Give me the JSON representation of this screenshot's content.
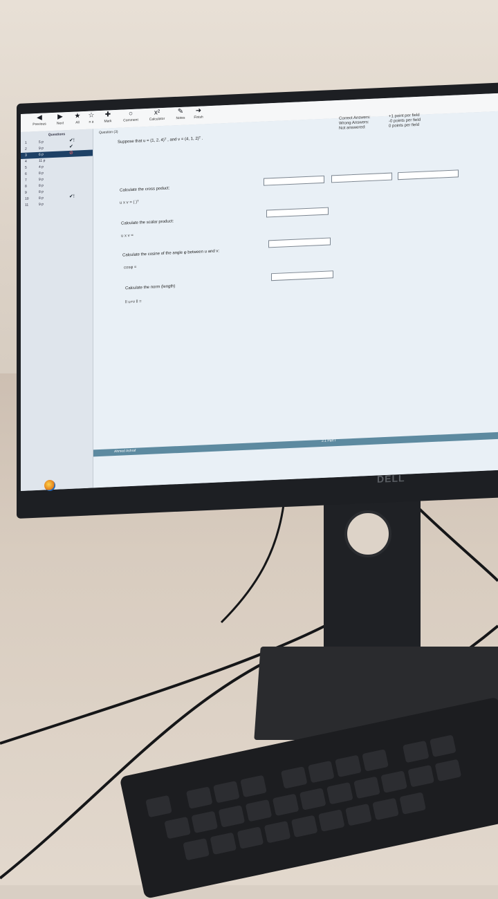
{
  "toolbar": {
    "previous": "Previous",
    "next": "Next",
    "all": "All",
    "na": "n a",
    "mark": "Mark",
    "comment": "Comment",
    "calculator": "Calculator",
    "notes": "Notes",
    "finish": "Finish"
  },
  "sidebar": {
    "title": "Questions",
    "items": [
      {
        "num": "1",
        "pts": "5 p",
        "status": "✔!"
      },
      {
        "num": "2",
        "pts": "9 p",
        "status": "✔"
      },
      {
        "num": "3",
        "pts": "6 p",
        "status": "⊘"
      },
      {
        "num": "4",
        "pts": "11 p",
        "status": ""
      },
      {
        "num": "5",
        "pts": "4 p",
        "status": ""
      },
      {
        "num": "6",
        "pts": "8 p",
        "status": ""
      },
      {
        "num": "7",
        "pts": "9 p",
        "status": ""
      },
      {
        "num": "8",
        "pts": "8 p",
        "status": ""
      },
      {
        "num": "9",
        "pts": "8 p",
        "status": ""
      },
      {
        "num": "10",
        "pts": "8 p",
        "status": "✔!"
      },
      {
        "num": "11",
        "pts": "9 p",
        "status": ""
      }
    ]
  },
  "question": {
    "title": "Question (3)",
    "stem": "Suppose that u = (1, 2, 4)ᵀ , and v = (4, 1, 2)ᵀ .",
    "scoring": {
      "correct_label": "Correct Answers:",
      "correct_value": "+1 point per field",
      "wrong_label": "Wrong Answers:",
      "wrong_value": "-0 points per field",
      "na_label": "Not answered:",
      "na_value": "0 points per field"
    },
    "parts": [
      {
        "label": "Calculate the cross poduct:",
        "sub": "u x v = (          )ᵀ"
      },
      {
        "label": "Calculate the scalar product:",
        "sub": "u x v ="
      },
      {
        "label": "Calculate the cosine of the angle φ between u and v:",
        "sub": "cosφ ="
      },
      {
        "label": "Calculate the norm (length)",
        "sub": "ll u+v ll ="
      }
    ]
  },
  "footer": {
    "user": "Ahmed Ashraf",
    "part": "2.1 Part I"
  },
  "hardware": {
    "brand": "DELL"
  }
}
